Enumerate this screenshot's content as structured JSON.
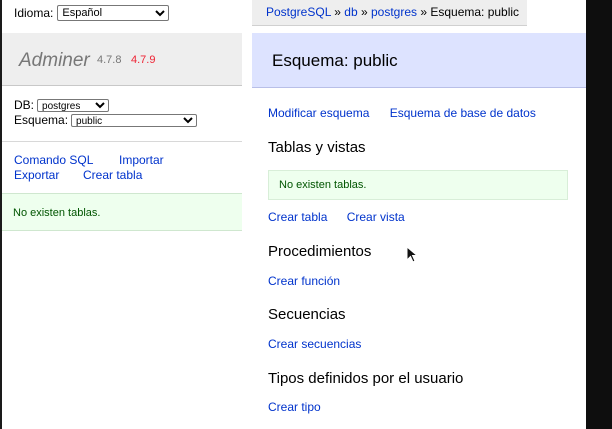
{
  "menu": {
    "language_label": "Idioma:",
    "language_value": "Español",
    "app_name": "Adminer",
    "version": "4.7.8",
    "new_version": "4.7.9",
    "db_label": "DB:",
    "db_value": "postgres",
    "schema_label": "Esquema:",
    "schema_value": "public",
    "links": [
      "Comando SQL",
      "Importar",
      "Exportar",
      "Crear tabla"
    ],
    "notice": "No existen tablas."
  },
  "breadcrumb": [
    "PostgreSQL",
    "db",
    "postgres",
    "Esquema: public"
  ],
  "page": {
    "title": "Esquema: public",
    "top_links": [
      "Modificar esquema",
      "Esquema de base de datos"
    ],
    "sections": [
      {
        "heading": "Tablas y vistas",
        "notice": "No existen tablas.",
        "links": [
          "Crear tabla",
          "Crear vista"
        ]
      },
      {
        "heading": "Procedimientos",
        "links": [
          "Crear función"
        ]
      },
      {
        "heading": "Secuencias",
        "links": [
          "Crear secuencias"
        ]
      },
      {
        "heading": "Tipos definidos por el usuario",
        "links": [
          "Crear tipo"
        ]
      }
    ]
  },
  "colors": {
    "link": "#0033cc",
    "title_bar": "#dde3ff",
    "notice_bg": "#eeffee",
    "new_version": "#ee2233"
  },
  "icons": [
    "dropdown-arrow-icon",
    "mouse-cursor-icon"
  ]
}
